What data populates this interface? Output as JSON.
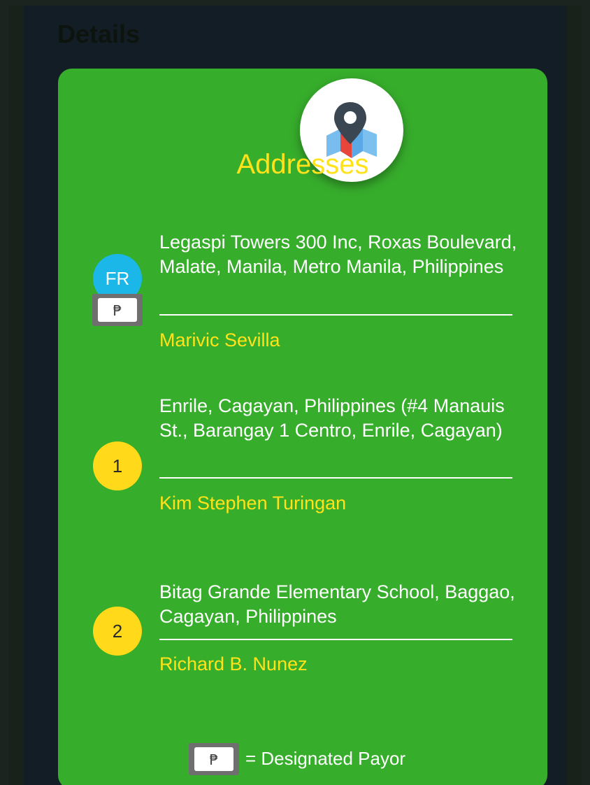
{
  "backdrop": {
    "title": "Details"
  },
  "card": {
    "title": "Addresses",
    "header_icon": "map-pin-icon",
    "entries": [
      {
        "marker": "FR",
        "address": "Legaspi Towers 300 Inc, Roxas Boulevard, Malate, Manila, Metro Manila, Philippines",
        "name": "Marivic Sevilla",
        "designated_payor": true
      },
      {
        "marker": "1",
        "address": "Enrile, Cagayan, Philippines (#4 Manauis St., Barangay 1 Centro, Enrile, Cagayan)",
        "name": "Kim Stephen Turingan",
        "designated_payor": false
      },
      {
        "marker": "2",
        "address": "Bitag Grande Elementary School, Baggao, Cagayan, Philippines",
        "name": "Richard B. Nunez",
        "designated_payor": false
      }
    ],
    "legend": {
      "icon": "peso-bill-icon",
      "text": "= Designated Payor"
    }
  },
  "colors": {
    "card_green": "#37ad2c",
    "accent_yellow": "#ffe21a",
    "marker_blue": "#1ab7e8",
    "marker_yellow": "#ffd91a",
    "backdrop_navy": "#121d26"
  }
}
